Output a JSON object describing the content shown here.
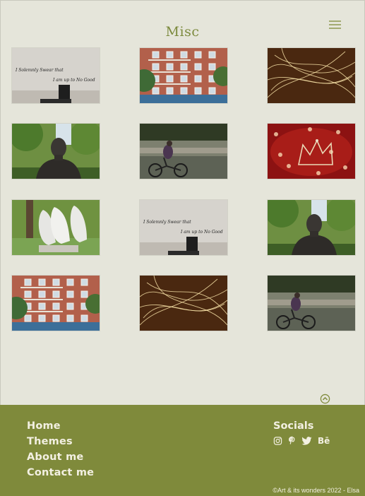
{
  "page": {
    "title": "Misc"
  },
  "gallery": {
    "images": [
      {
        "subject": "wall-quote",
        "quote_line1": "I Solemnly Swear that",
        "quote_line2": "I am up to No Good"
      },
      {
        "subject": "apartment-building"
      },
      {
        "subject": "light-trails"
      },
      {
        "subject": "bust-statue"
      },
      {
        "subject": "cyclist"
      },
      {
        "subject": "red-crown"
      },
      {
        "subject": "white-face-sculptures"
      },
      {
        "subject": "wall-quote",
        "quote_line1": "I Solemnly Swear that",
        "quote_line2": "I am up to No Good"
      },
      {
        "subject": "bust-statue"
      },
      {
        "subject": "apartment-building"
      },
      {
        "subject": "light-trails"
      },
      {
        "subject": "cyclist"
      }
    ]
  },
  "footer": {
    "nav": [
      "Home",
      "Themes",
      "About me",
      "Contact me"
    ],
    "socials_title": "Socials",
    "socials": [
      "instagram-icon",
      "pinterest-icon",
      "twitter-icon",
      "behance-icon"
    ],
    "behance_label": "Bē",
    "copyright": "©Art & its wonders 2022 - Elsa"
  },
  "colors": {
    "accent": "#7f8a3b",
    "background": "#e5e5da",
    "footer_text": "#f3f0e2"
  }
}
